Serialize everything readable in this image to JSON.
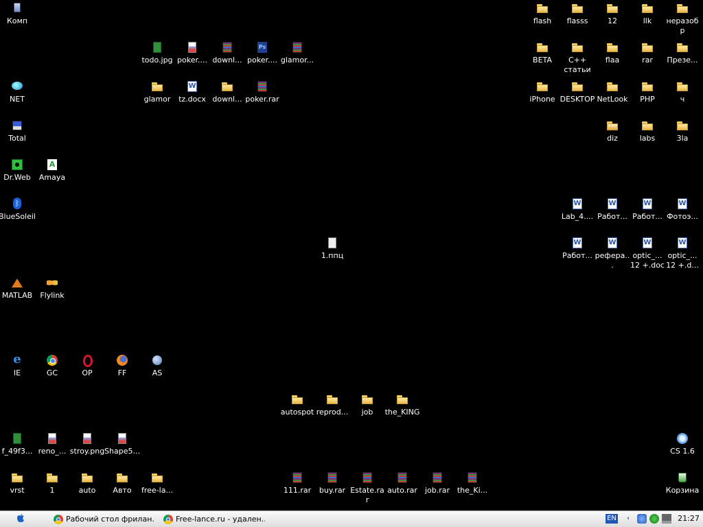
{
  "desktop": {
    "icons": [
      {
        "label": "Комп",
        "type": "pc-icon",
        "cls": "pc"
      },
      {
        "label": "NET",
        "type": "network-icon",
        "cls": "net"
      },
      {
        "label": "Total",
        "type": "floppy-disk-icon",
        "cls": "disk"
      },
      {
        "label": "Dr.Web",
        "type": "spider-icon",
        "cls": "spider"
      },
      {
        "label": "Amaya",
        "type": "amaya-icon",
        "cls": "amaya"
      },
      {
        "label": "BlueSoleil",
        "type": "bluetooth-icon",
        "cls": "bt"
      },
      {
        "label": "MATLAB",
        "type": "matlab-icon",
        "cls": "matlab"
      },
      {
        "label": "Flylink",
        "type": "butterfly-icon",
        "cls": "butterfly"
      },
      {
        "label": "IE",
        "type": "internet-explorer-icon",
        "cls": "ie"
      },
      {
        "label": "GC",
        "type": "chrome-icon",
        "cls": "chrome"
      },
      {
        "label": "OP",
        "type": "opera-icon",
        "cls": "opera"
      },
      {
        "label": "FF",
        "type": "firefox-icon",
        "cls": "ff"
      },
      {
        "label": "AS",
        "type": "globe-icon",
        "cls": "globe"
      },
      {
        "label": "f_49f3...",
        "type": "image-file-icon",
        "cls": "jpg"
      },
      {
        "label": "reno_...",
        "type": "png-file-icon",
        "cls": "img"
      },
      {
        "label": "stroy.png",
        "type": "png-file-icon",
        "cls": "img"
      },
      {
        "label": "Shape5...",
        "type": "png-file-icon",
        "cls": "img"
      },
      {
        "label": "vrst",
        "type": "folder-icon",
        "cls": "folder"
      },
      {
        "label": "1",
        "type": "folder-icon",
        "cls": "folder"
      },
      {
        "label": "auto",
        "type": "folder-icon",
        "cls": "folder"
      },
      {
        "label": "Авто",
        "type": "folder-icon",
        "cls": "folder"
      },
      {
        "label": "free-la...",
        "type": "folder-icon",
        "cls": "folder"
      },
      {
        "label": "todo.jpg",
        "type": "image-file-icon",
        "cls": "jpg"
      },
      {
        "label": "poker....",
        "type": "png-file-icon",
        "cls": "img"
      },
      {
        "label": "downl...",
        "type": "rar-archive-icon",
        "cls": "rar"
      },
      {
        "label": "poker....",
        "type": "psd-file-icon",
        "cls": "psd"
      },
      {
        "label": "glamor...",
        "type": "rar-archive-icon",
        "cls": "rar"
      },
      {
        "label": "glamor",
        "type": "folder-icon",
        "cls": "folder"
      },
      {
        "label": "tz.docx",
        "type": "word-document-icon",
        "cls": "doc"
      },
      {
        "label": "downl...",
        "type": "folder-icon",
        "cls": "folder"
      },
      {
        "label": "poker.rar",
        "type": "rar-archive-icon",
        "cls": "rar"
      },
      {
        "label": "1.ппц",
        "type": "file-icon",
        "cls": "ppc"
      },
      {
        "label": "autospot",
        "type": "folder-icon",
        "cls": "folder"
      },
      {
        "label": "reprod...",
        "type": "folder-icon",
        "cls": "folder"
      },
      {
        "label": "job",
        "type": "folder-icon",
        "cls": "folder"
      },
      {
        "label": "the_KING",
        "type": "folder-icon",
        "cls": "folder"
      },
      {
        "label": "111.rar",
        "type": "rar-archive-icon",
        "cls": "rar"
      },
      {
        "label": "buy.rar",
        "type": "rar-archive-icon",
        "cls": "rar"
      },
      {
        "label": "Estate.rar",
        "type": "rar-archive-icon",
        "cls": "rar"
      },
      {
        "label": "auto.rar",
        "type": "rar-archive-icon",
        "cls": "rar"
      },
      {
        "label": "job.rar",
        "type": "rar-archive-icon",
        "cls": "rar"
      },
      {
        "label": "the_Ki...",
        "type": "rar-archive-icon",
        "cls": "rar"
      },
      {
        "label": "flash",
        "type": "folder-icon",
        "cls": "folder"
      },
      {
        "label": "flasss",
        "type": "folder-icon",
        "cls": "folder"
      },
      {
        "label": "12",
        "type": "folder-icon",
        "cls": "folder"
      },
      {
        "label": "llk",
        "type": "folder-icon",
        "cls": "folder"
      },
      {
        "label": "неразобр",
        "type": "folder-icon",
        "cls": "folder"
      },
      {
        "label": "BETA",
        "type": "folder-icon",
        "cls": "folder"
      },
      {
        "label": "C++ статьи",
        "type": "folder-icon",
        "cls": "folder"
      },
      {
        "label": "flaa",
        "type": "folder-icon",
        "cls": "folder"
      },
      {
        "label": "rar",
        "type": "folder-icon",
        "cls": "folder"
      },
      {
        "label": "Презе...",
        "type": "folder-icon",
        "cls": "folder"
      },
      {
        "label": "iPhone",
        "type": "folder-icon",
        "cls": "folder"
      },
      {
        "label": "DESKTOP",
        "type": "folder-icon",
        "cls": "folder"
      },
      {
        "label": "NetLook",
        "type": "folder-icon",
        "cls": "folder"
      },
      {
        "label": "PHP",
        "type": "folder-icon",
        "cls": "folder"
      },
      {
        "label": "ч",
        "type": "folder-icon",
        "cls": "folder"
      },
      {
        "label": "diz",
        "type": "open-folder-icon",
        "cls": "folder openfolder"
      },
      {
        "label": "labs",
        "type": "folder-icon",
        "cls": "folder"
      },
      {
        "label": "3la",
        "type": "folder-icon",
        "cls": "folder"
      },
      {
        "label": "Lab_4....",
        "type": "word-document-icon",
        "cls": "doc"
      },
      {
        "label": "Работ...",
        "type": "word-document-icon",
        "cls": "doc"
      },
      {
        "label": "Работ...",
        "type": "word-document-icon",
        "cls": "doc"
      },
      {
        "label": "Фотоэ...",
        "type": "word-document-icon",
        "cls": "doc"
      },
      {
        "label": "Работ...",
        "type": "word-document-icon",
        "cls": "doc"
      },
      {
        "label": "рефера...",
        "type": "word-document-icon",
        "cls": "doc"
      },
      {
        "label": "optic_... 12 +.doc",
        "type": "word-document-icon",
        "cls": "doc"
      },
      {
        "label": "optic_... 12 +.d...",
        "type": "word-document-icon",
        "cls": "doc"
      },
      {
        "label": "CS 1.6",
        "type": "cs-game-icon",
        "cls": "cs"
      },
      {
        "label": "Корзина",
        "type": "recycle-bin-icon",
        "cls": "bin"
      }
    ]
  },
  "taskbar": {
    "tasks": [
      {
        "label": "Рабочий стол фрилан...",
        "icon": "chrome-icon"
      },
      {
        "label": "Free-lance.ru - удален...",
        "icon": "chrome-icon"
      }
    ],
    "language": "EN",
    "clock": "21:27"
  }
}
